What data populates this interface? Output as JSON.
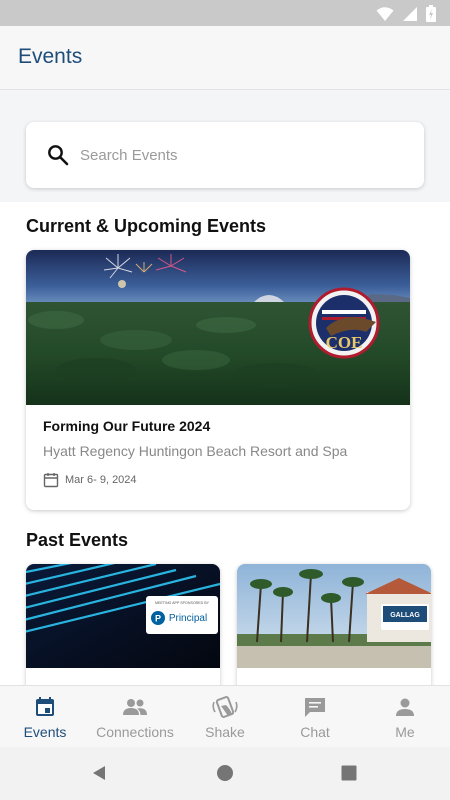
{
  "header": {
    "title": "Events"
  },
  "search": {
    "placeholder": "Search Events",
    "value": ""
  },
  "sections": {
    "current_title": "Current & Upcoming Events",
    "past_title": "Past Events"
  },
  "current_event": {
    "name": "Forming Our Future 2024",
    "venue": "Hyatt Regency Huntingon Beach Resort and Spa",
    "date": "Mar 6- 9, 2024",
    "logo_text": "COE"
  },
  "past_events": [
    {
      "sponsor_caption": "MEETING APP SPONSORED BY",
      "logo_text": "Principal"
    },
    {
      "logo_text": "GALLAG"
    }
  ],
  "nav": {
    "items": [
      {
        "label": "Events",
        "icon": "calendar-icon",
        "active": true
      },
      {
        "label": "Connections",
        "icon": "people-icon",
        "active": false
      },
      {
        "label": "Shake",
        "icon": "shake-hand-icon",
        "active": false
      },
      {
        "label": "Chat",
        "icon": "chat-bubble-icon",
        "active": false
      },
      {
        "label": "Me",
        "icon": "person-icon",
        "active": false
      }
    ]
  },
  "colors": {
    "accent": "#1f4d7a",
    "inactive": "#9a9a9a",
    "statusbar": "#c9c9c9"
  }
}
